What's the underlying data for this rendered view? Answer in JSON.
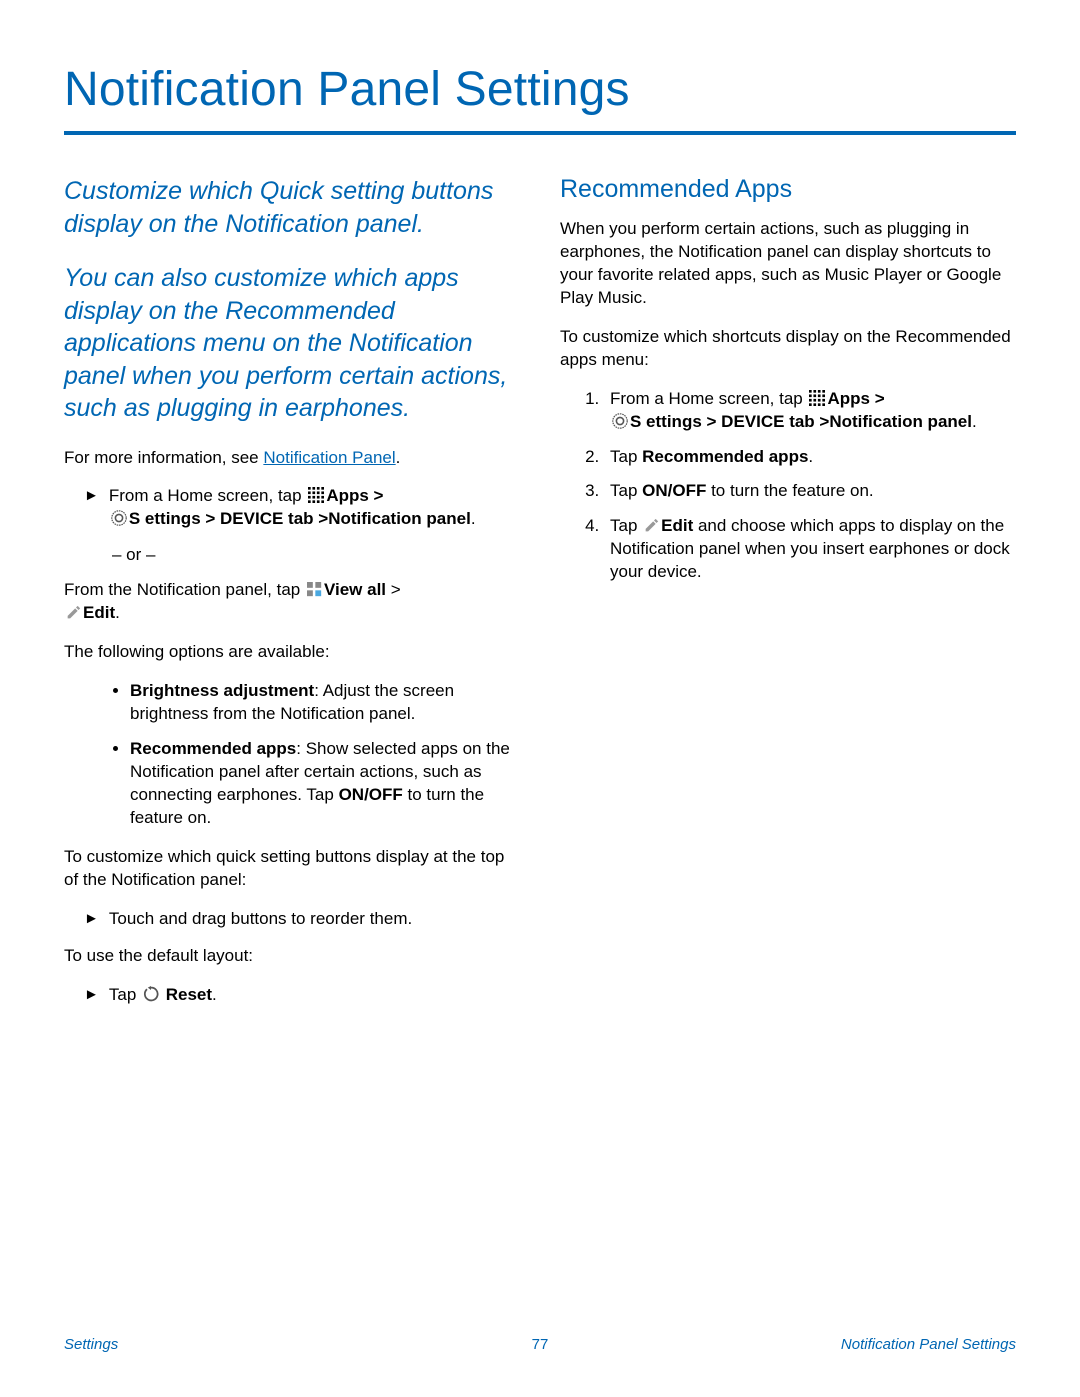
{
  "title": "Notification Panel Settings",
  "intro1": "Customize which Quick setting buttons display on the Notification panel.",
  "intro2": "You can also customize which apps display on the Recommended applications menu on the Notification panel when you perform certain actions, such as plugging in earphones.",
  "more_info_prefix": "For more information, see ",
  "more_info_link": "Notification Panel",
  "more_info_suffix": ".",
  "home_tap_prefix": "From a Home screen, tap ",
  "apps_label": "Apps",
  "gt": " > ",
  "settings_label": "S ettings",
  "device_tab": " > DEVICE tab >",
  "notif_panel_label": "Notification panel",
  "period": ".",
  "or": "– or –",
  "from_panel_tap": "From the Notification panel, tap ",
  "view_all": "View all",
  "space_gt": "  > ",
  "edit": "Edit",
  "options_avail": "The following options are available:",
  "opt1_bold": "Brightness adjustment",
  "opt1_text": ": Adjust the screen brightness from the Notification panel.",
  "opt2_bold": "Recommended apps",
  "opt2_text1": ": Show selected apps on the Notification panel after certain actions, such as connecting earphones. Tap ",
  "onoff": "ON/OFF",
  "opt2_text2": " to turn the feature on.",
  "custom_quick": "To customize which quick setting buttons display at the top of the Notification panel:",
  "drag_reorder": "Touch and drag buttons to reorder them.",
  "default_layout": "To use the default layout:",
  "tap_word": "Tap ",
  "reset": " Reset",
  "rec_heading": "Recommended Apps",
  "rec_p1": "When you perform certain actions, such as plugging in earphones, the Notification panel can display shortcuts to your favorite related apps, such as Music Player or Google Play Music.",
  "rec_p2": "To customize which shortcuts display on the Recommended apps menu:",
  "step2_prefix": "Tap ",
  "step2_bold": "Recommended apps",
  "step3_prefix": "Tap ",
  "step3_suffix": " to turn the feature on.",
  "step4_prefix": "Tap ",
  "step4_bold": "Edit",
  "step4_suffix": " and choose which apps to display on the Notification panel when you insert earphones or dock your device.",
  "footer_left": "Settings",
  "footer_page": "77",
  "footer_right": "Notification Panel Settings"
}
